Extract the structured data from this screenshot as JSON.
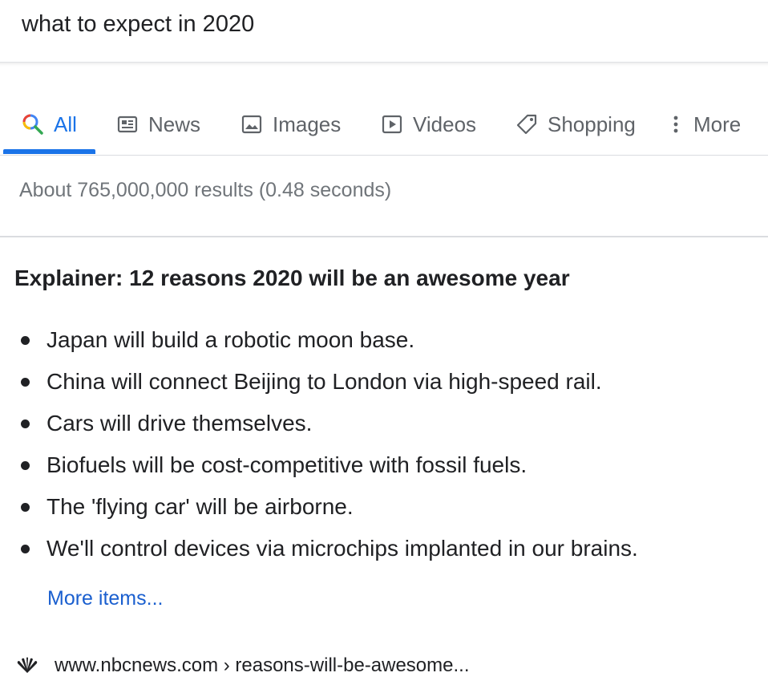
{
  "search": {
    "query": "what to expect in 2020"
  },
  "tabs": [
    {
      "label": "All",
      "icon": "search-icon",
      "active": true
    },
    {
      "label": "News",
      "icon": "news-icon"
    },
    {
      "label": "Images",
      "icon": "image-icon"
    },
    {
      "label": "Videos",
      "icon": "play-icon"
    },
    {
      "label": "Shopping",
      "icon": "tag-icon"
    },
    {
      "label": "More",
      "icon": "more-vertical-icon"
    }
  ],
  "result_stats": "About 765,000,000 results (0.48 seconds)",
  "snippet": {
    "heading": "Explainer: 12 reasons 2020 will be an awesome year",
    "items": [
      "Japan will build a robotic moon base.",
      "China will connect Beijing to London via high-speed rail.",
      "Cars will drive themselves.",
      "Biofuels will be cost-competitive with fossil fuels.",
      "The 'flying car' will be airborne.",
      "We'll control devices via microchips implanted in our brains."
    ],
    "more_items": "More items..."
  },
  "source": {
    "url": "www.nbcnews.com › reasons-will-be-awesome...",
    "logo": "nbc-peacock-icon"
  },
  "colors": {
    "accent": "#1a73e8",
    "link": "#1a5fcf",
    "text": "#202124",
    "muted": "#5f6368",
    "stats": "#70757a"
  }
}
